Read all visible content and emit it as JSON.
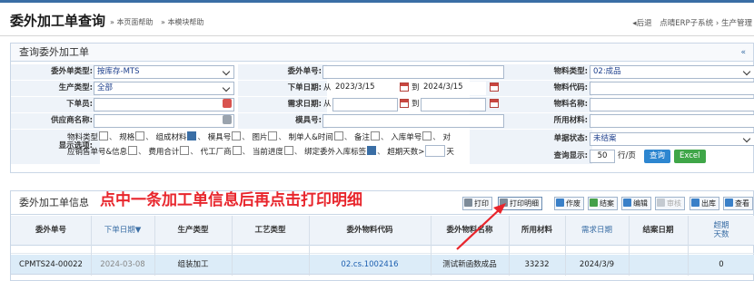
{
  "header": {
    "title": "委外加工单查询",
    "help_page": "» 本页面帮助",
    "help_module": "» 本模块帮助",
    "back": "◂后退",
    "breadcrumb": "点晴ERP子系统 › 生产管理"
  },
  "query_panel": {
    "title": "查询委外加工单",
    "collapse_icon": "«",
    "fields": {
      "order_type_label": "委外单类型:",
      "order_type_value": "按库存-MTS",
      "order_no_label": "委外单号:",
      "material_type_label": "物料类型:",
      "material_type_value": "02:成品",
      "production_type_label": "生产类型:",
      "production_type_value": "全部",
      "order_date_label": "下单日期:",
      "from_label": "从",
      "to_label": "到",
      "order_date_from": "2023/3/15",
      "order_date_to": "2024/3/15",
      "material_code_label": "物料代码:",
      "creator_label": "下单员:",
      "demand_date_label": "需求日期:",
      "material_name_label": "物料名称:",
      "supplier_label": "供应商名称:",
      "template_label": "模具号:",
      "used_material_label": "所用材料:",
      "display_label": "显示选项:",
      "status_label": "单据状态:",
      "status_value": "未结案",
      "query_display_label": "查询显示:",
      "page_size": "50",
      "page_unit": "行/页",
      "query_button": "查询",
      "excel_button": "Excel"
    },
    "options_line1": [
      "物料类型",
      "规格",
      "组成材料",
      "模具号",
      "图片",
      "制单人&时间",
      "备注",
      "入库单号",
      "对"
    ],
    "options_line2": [
      "应销售单号&信息",
      "费用合计",
      "代工厂商",
      "当前进度",
      "绑定委外入库标签",
      "超期天数>",
      "天"
    ]
  },
  "result_panel": {
    "title": "委外加工单信息",
    "annotation": "点中一条加工单信息后再点击打印明细",
    "toolbar": [
      "打印",
      "打印明细",
      "作废",
      "结案",
      "编辑",
      "审核",
      "出库",
      "查看"
    ],
    "columns": [
      "委外单号",
      "下单日期▼",
      "生产类型",
      "工艺类型",
      "委外物料代码",
      "委外物料名称",
      "所用材料",
      "需求日期",
      "结案日期",
      "超期天数"
    ],
    "rows": [
      {
        "order_no": "CPMTS24-00022",
        "order_date": "2024-03-08",
        "production_type": "组装加工",
        "process_type": "",
        "material_code": "02.cs.1002416",
        "material_name": "测试新函数成品",
        "used_material": "33232",
        "demand_date": "2024/3/9",
        "close_date": "",
        "overdue_days": "0"
      }
    ]
  },
  "colors": {
    "accent": "#3a6ea5",
    "annotation_red": "#e8252c",
    "query_button": "#2d86d0",
    "excel_button": "#3fa648",
    "selected_row": "#dcecf8"
  }
}
